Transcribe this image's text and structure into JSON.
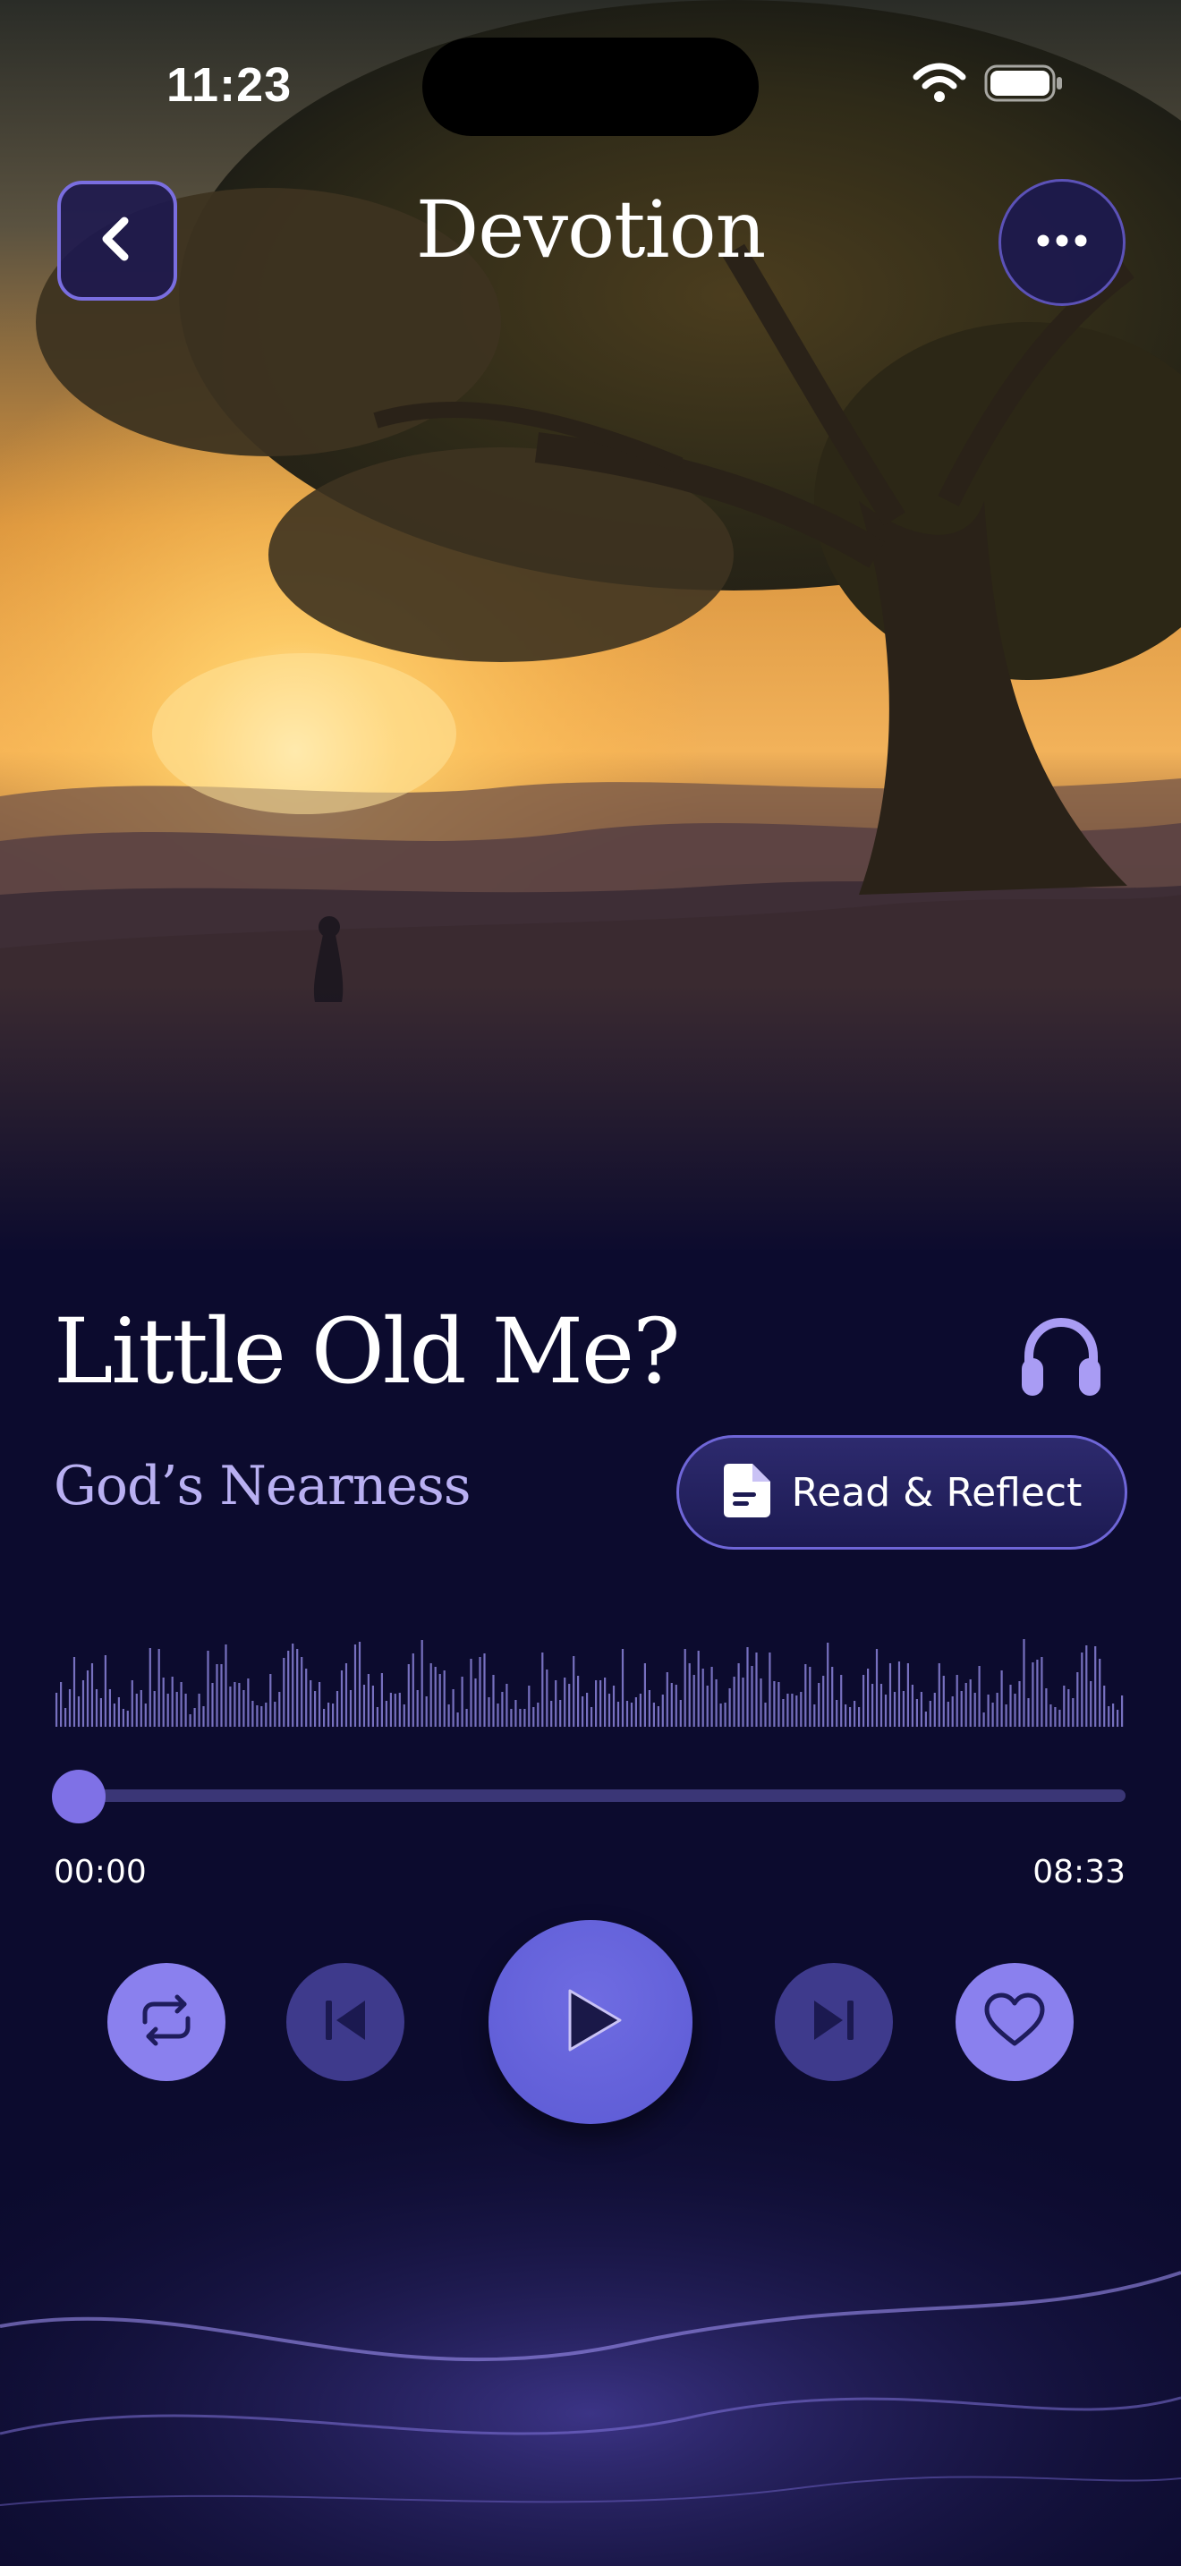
{
  "status_bar": {
    "time": "11:23"
  },
  "nav": {
    "title": "Devotion"
  },
  "track": {
    "title": "Little Old Me?",
    "subtitle": "God’s Nearness",
    "read_label": "Read & Reflect"
  },
  "playback": {
    "elapsed": "00:00",
    "total": "08:33",
    "progress": 0.0
  },
  "colors": {
    "background": "#0c0b2e",
    "accent": "#8a80ee",
    "play": "#5f5cd6",
    "secondary_control": "#3e3a8c",
    "subtitle": "#b9b0f2"
  },
  "icons": {
    "back": "chevron-left-icon",
    "more": "ellipsis-icon",
    "listen": "headphones-icon",
    "read": "document-icon",
    "repeat": "repeat-icon",
    "previous": "skip-previous-icon",
    "play": "play-icon",
    "next": "skip-next-icon",
    "favorite": "heart-icon"
  }
}
